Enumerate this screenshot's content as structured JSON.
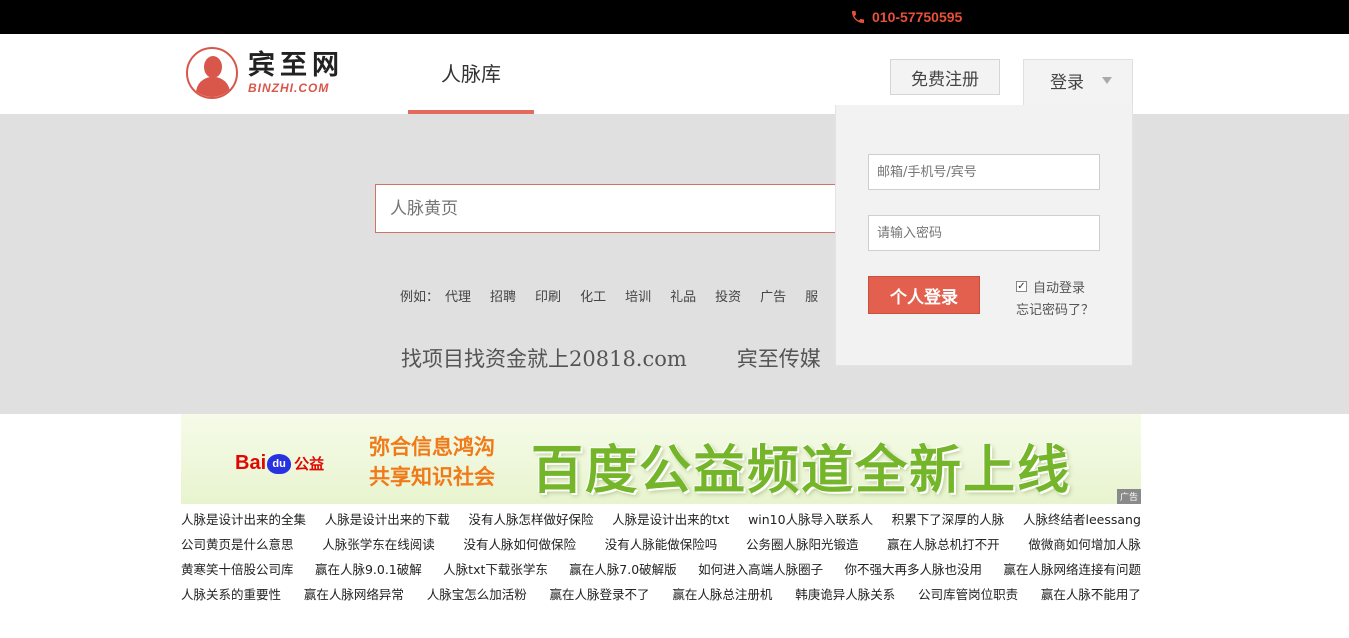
{
  "topbar": {
    "phone": "010-57750595",
    "icon": "phone-icon"
  },
  "header": {
    "logo_cn": "宾至网",
    "logo_en": "BINZHI.COM",
    "nav_tab": "人脉库",
    "register_label": "免费注册",
    "login_label": "登录"
  },
  "search": {
    "placeholder": "人脉黄页",
    "hint_prefix": "例如：",
    "hints": [
      "代理",
      "招聘",
      "印刷",
      "化工",
      "培训",
      "礼品",
      "投资",
      "广告",
      "服"
    ]
  },
  "slogans": [
    "找项目找资金就上20818.com",
    "宾至传媒"
  ],
  "login_panel": {
    "username_placeholder": "邮箱/手机号/宾号",
    "password_placeholder": "请输入密码",
    "submit_label": "个人登录",
    "auto_login_label": "自动登录",
    "auto_login_checked": true,
    "forgot_label": "忘记密码了？"
  },
  "banner": {
    "brand_bai": "Bai",
    "brand_du": "du",
    "brand_gy": "公益",
    "tagline_1": "弥合信息鸿沟",
    "tagline_2": "共享知识社会",
    "headline": "百度公益频道全新上线",
    "ad_label": "广告"
  },
  "links": [
    [
      "人脉是设计出来的全集",
      "人脉是设计出来的下载",
      "没有人脉怎样做好保险",
      "人脉是设计出来的txt",
      "win10人脉导入联系人",
      "积累下了深厚的人脉",
      "人脉终结者leessang"
    ],
    [
      "公司黄页是什么意思",
      "人脉张学东在线阅读",
      "没有人脉如何做保险",
      "没有人脉能做保险吗",
      "公务圈人脉阳光锻造",
      "赢在人脉总机打不开",
      "做微商如何增加人脉"
    ],
    [
      "黄寒笑十倍股公司库",
      "赢在人脉9.0.1破解",
      "人脉txt下载张学东",
      "赢在人脉7.0破解版",
      "如何进入高端人脉圈子",
      "你不强大再多人脉也没用",
      "赢在人脉网络连接有问题"
    ],
    [
      "人脉关系的重要性",
      "赢在人脉网络异常",
      "人脉宝怎么加活粉",
      "赢在人脉登录不了",
      "赢在人脉总注册机",
      "韩庚诡异人脉关系",
      "公司库管岗位职责",
      "赢在人脉不能用了"
    ]
  ]
}
